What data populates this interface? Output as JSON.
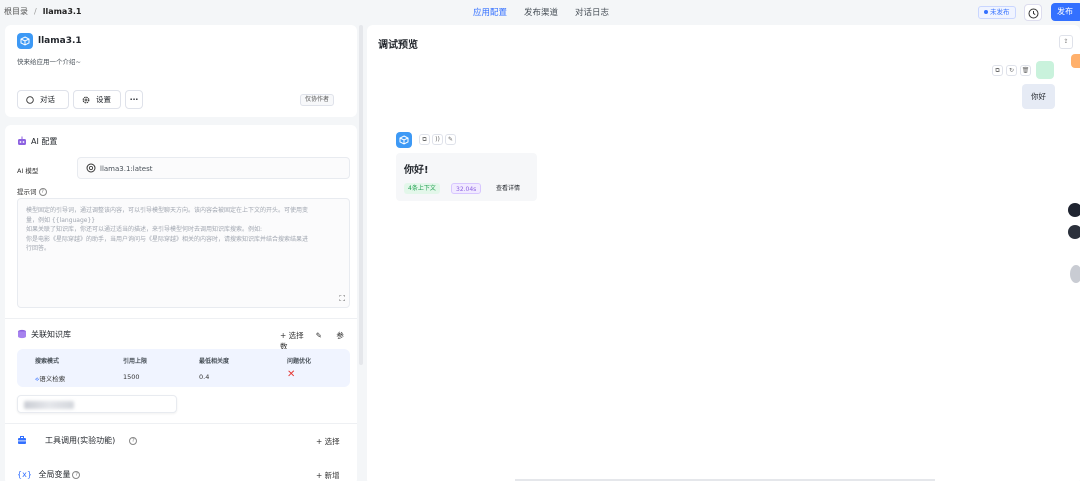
{
  "topbar": {
    "breadcrumb_root": "根目录",
    "breadcrumb_sep": "/",
    "breadcrumb_current": "llama3.1",
    "tabs": [
      {
        "label": "应用配置",
        "active": true
      },
      {
        "label": "发布渠道",
        "active": false
      },
      {
        "label": "对话日志",
        "active": false
      }
    ],
    "status": "未发布",
    "publish_label": "发布"
  },
  "app": {
    "name": "llama3.1",
    "intro": "快来给应用一个介绍~",
    "chat_label": "对话",
    "settings_label": "设置",
    "more_label": "···",
    "author_only": "仅协作者"
  },
  "config": {
    "ai_section": "AI 配置",
    "model_label": "AI 模型",
    "model_value": "llama3.1:latest",
    "prompt_label": "提示词",
    "prompt_placeholder_lines": [
      "模型固定的引导词，通过调整该内容，可以引导模型聊天方向。该内容会被固定在上下文的开头。可使用变",
      "量，例如 {{language}}",
      "如果关联了知识库，你还可以通过适当的描述，来引导模型何时去调用知识库搜索。例如:",
      "你是电影《星际穿越》的助手，当用户询问与《星际穿越》相关的内容时，请搜索知识库并结合搜索结果进",
      "行回答。"
    ],
    "expand_icon": "⛶",
    "kb_section": "关联知识库",
    "kb_select": "+ 选择",
    "kb_params": "参数",
    "kb_table": {
      "headers": [
        "搜索模式",
        "引用上限",
        "最低相关度",
        "问题优化"
      ],
      "values": [
        "语义检索",
        "1500",
        "0.4",
        "✕"
      ]
    },
    "tool_section": "工具调用(实验功能)",
    "tool_select": "+ 选择",
    "var_section": "全局变量",
    "var_brace": "{x}",
    "var_add": "+ 新增"
  },
  "preview": {
    "title": "调试预览",
    "user_message": "你好",
    "ai_message": "你好!",
    "context_tag": "4条上下文",
    "time_tag": "32.04s",
    "detail_link": "查看详情"
  },
  "colors": {
    "accent": "#3370ff",
    "app_icon": "#3d99f5",
    "error": "#e53935"
  }
}
